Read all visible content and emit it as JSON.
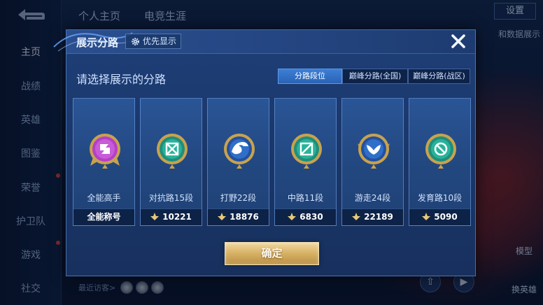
{
  "background": {
    "nav_items": [
      {
        "label": "主页"
      },
      {
        "label": "战绩"
      },
      {
        "label": "英雄"
      },
      {
        "label": "图鉴"
      },
      {
        "label": "荣誉"
      },
      {
        "label": "护卫队"
      },
      {
        "label": "游戏"
      },
      {
        "label": "社交"
      }
    ],
    "top_tabs": [
      "个人主页",
      "电竞生涯"
    ],
    "settings_label": "设置",
    "right_text": "和数据展示",
    "model_label": "模型",
    "change_hero_label": "换英雄",
    "visitor_label": "最近访客>"
  },
  "modal": {
    "title": "展示分路",
    "priority_label": "优先显示",
    "select_label": "请选择展示的分路",
    "segments": [
      "分路段位",
      "巅峰分路(全国)",
      "巅峰分路(战区)"
    ],
    "active_segment": 0,
    "cards": [
      {
        "name": "全能高手",
        "footer": "全能称号",
        "emblem": "all-round-emblem-icon",
        "color": "#b43fc7"
      },
      {
        "name": "对抗路15段",
        "score": "10221",
        "emblem": "clash-lane-emblem-icon",
        "color": "#27b39a"
      },
      {
        "name": "打野22段",
        "score": "18876",
        "emblem": "jungle-emblem-icon",
        "color": "#2f6fc9"
      },
      {
        "name": "中路11段",
        "score": "6830",
        "emblem": "mid-lane-emblem-icon",
        "color": "#27b39a"
      },
      {
        "name": "游走24段",
        "score": "22189",
        "emblem": "roam-emblem-icon",
        "color": "#2f6fc9"
      },
      {
        "name": "发育路10段",
        "score": "5090",
        "emblem": "farm-lane-emblem-icon",
        "color": "#27b39a"
      }
    ],
    "confirm_label": "确定"
  },
  "colors": {
    "accent_blue": "#2a63b4",
    "gold_button": "#d9b468",
    "modal_bg": "#1a3668"
  }
}
